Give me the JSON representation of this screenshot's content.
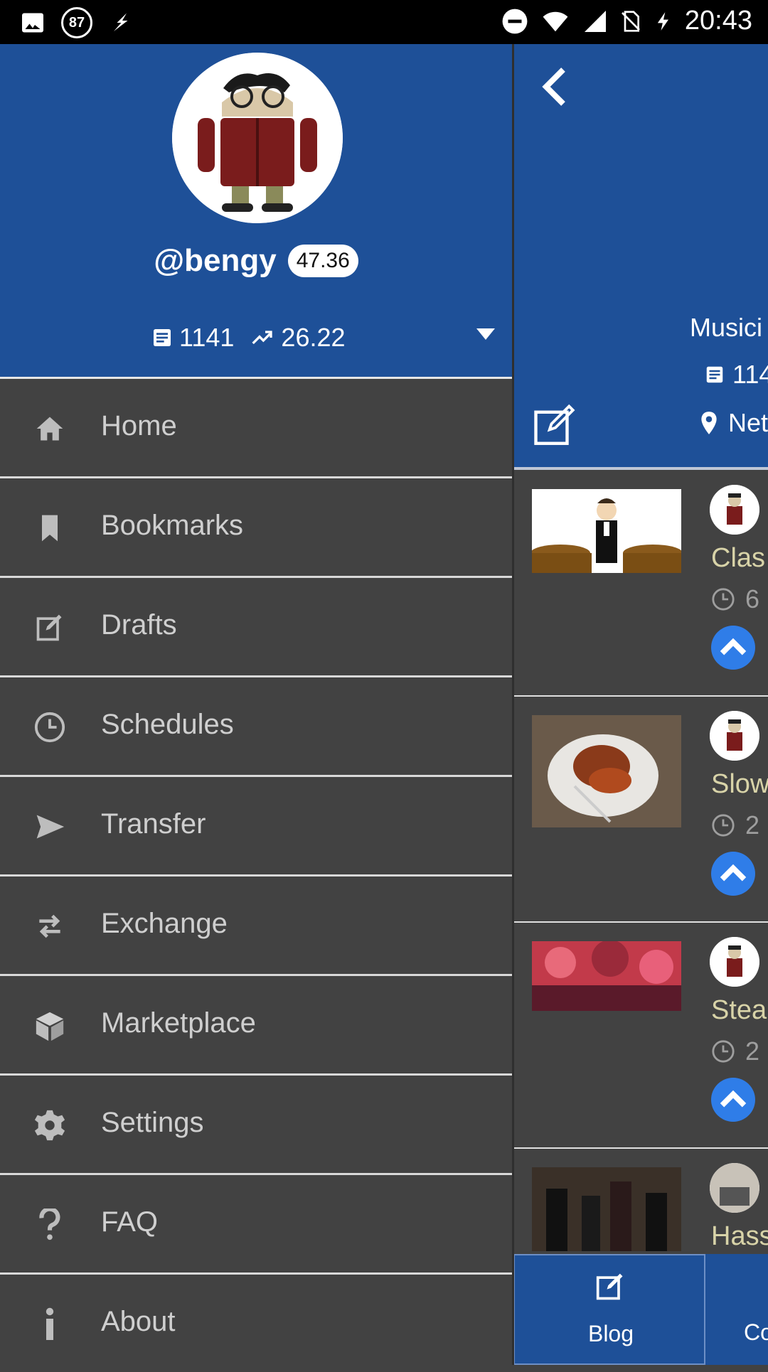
{
  "status_bar": {
    "notification_badge": "87",
    "time": "20:43",
    "left_icons": [
      "image-icon",
      "badge-icon",
      "lightning-app-icon"
    ],
    "right_icons": [
      "do-not-disturb-icon",
      "wifi-icon",
      "signal-icon",
      "no-sim-icon",
      "charging-icon"
    ]
  },
  "drawer": {
    "username": "@bengy",
    "reputation": "47.36",
    "post_count": "1141",
    "voting_power": "26.22",
    "menu": [
      {
        "label": "Home",
        "icon": "home-icon"
      },
      {
        "label": "Bookmarks",
        "icon": "bookmark-icon"
      },
      {
        "label": "Drafts",
        "icon": "edit-icon"
      },
      {
        "label": "Schedules",
        "icon": "clock-icon"
      },
      {
        "label": "Transfer",
        "icon": "send-icon"
      },
      {
        "label": "Exchange",
        "icon": "swap-icon"
      },
      {
        "label": "Marketplace",
        "icon": "cube-icon"
      },
      {
        "label": "Settings",
        "icon": "gear-icon"
      },
      {
        "label": "FAQ",
        "icon": "question-icon"
      },
      {
        "label": "About",
        "icon": "info-icon"
      }
    ]
  },
  "profile": {
    "about_partial": "Musici",
    "post_count_partial": "114",
    "location_partial": "Net"
  },
  "feed": [
    {
      "title_partial": "Clas",
      "meta_partial": "6"
    },
    {
      "title_partial": "Slow",
      "meta_partial": "2"
    },
    {
      "title_partial": "Stea",
      "meta_partial": "2"
    },
    {
      "title_partial": "Hass",
      "meta_partial": ""
    }
  ],
  "bottom_nav": {
    "blog_label": "Blog",
    "second_label_partial": "Co"
  },
  "colors": {
    "primary": "#1e5098",
    "background": "#424242",
    "vote": "#2f7de8",
    "menu_text": "#cfcfcf"
  }
}
